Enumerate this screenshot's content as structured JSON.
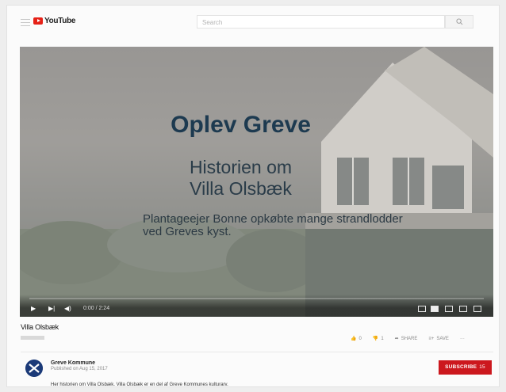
{
  "masthead": {
    "logo_text": "YouTube",
    "search_placeholder": "Search"
  },
  "player": {
    "overlay_title": "Oplev Greve",
    "overlay_subtitle_line1": "Historien om",
    "overlay_subtitle_line2": "Villa Olsbæk",
    "overlay_caption": "Plantageejer Bonne opkøbte mange strandlodder ved Greves kyst.",
    "time": "0:00 / 2:24",
    "progress_fraction": 0.0,
    "colors": {
      "title": "#1d3a50",
      "progress": "#f1f1f1"
    }
  },
  "video": {
    "title": "Villa Olsbæk"
  },
  "actions": {
    "likes": "0",
    "dislikes": "1",
    "share_label": "SHARE",
    "save_label": "SAVE"
  },
  "channel": {
    "name": "Greve Kommune",
    "published": "Published on Aug 15, 2017",
    "subscribe_label": "SUBSCRIBE",
    "subscriber_count": "15"
  },
  "description": "Her historien om Villa Olsbæk. Villa Olsbæk er en del af Greve Kommunes kulturarv.",
  "icons": [
    "menu-icon",
    "youtube-logo-icon",
    "search-icon",
    "play-icon",
    "next-icon",
    "volume-icon",
    "subtitles-icon",
    "settings-icon",
    "miniplayer-icon",
    "theater-icon",
    "fullscreen-icon",
    "thumbs-up-icon",
    "thumbs-down-icon",
    "share-icon",
    "save-icon",
    "more-icon"
  ]
}
